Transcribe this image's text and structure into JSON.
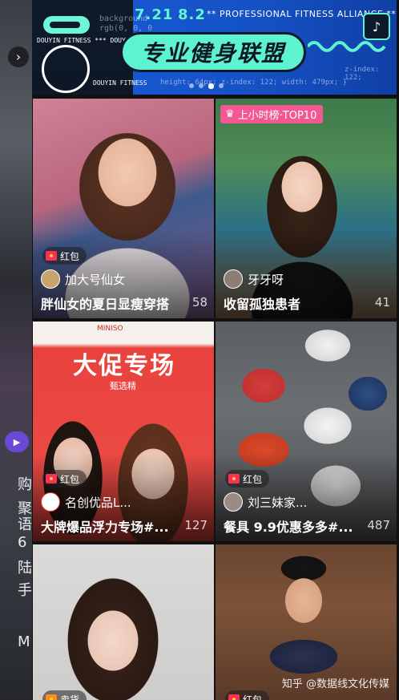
{
  "side": {
    "nav_arrow_icon": "chevron-right-icon",
    "text_items": [
      "购",
      "聚",
      "语",
      "6",
      "陆",
      "手",
      "M"
    ]
  },
  "banner": {
    "date1": "7.21",
    "date2": "8.2",
    "alliance": "** PROFESSIONAL  FITNESS  ALLIANCE **",
    "headline": "专业健身联盟",
    "code_line1": "background",
    "code_line2": "rgb(0, 0, 0",
    "code_line3": "height: 64px; z-index: 122; width: 479px; }",
    "code_line4": "z-index: 122;",
    "ring_tag1": "DOUYIN FITNESS *** DOUYIN FIT",
    "ring_tag2": "DOUYIN FITNESS",
    "colors": {
      "accent": "#5ef3d0",
      "blue": "#1a5bd9"
    }
  },
  "cards": [
    {
      "badge": "红包",
      "author": "加大号仙女",
      "title": "胖仙女的夏日显瘦穿搭",
      "count": "58",
      "rank": ""
    },
    {
      "badge": "",
      "author": "牙牙呀",
      "title": "收留孤独患者",
      "count": "41",
      "rank": "上小时榜·TOP10"
    },
    {
      "badge": "红包",
      "author": "名创优品L...",
      "title": "大牌爆品浮力专场#...",
      "count": "127",
      "rank": "",
      "poster_title": "大促专场",
      "poster_sub": "甄选精",
      "poster_brand": "MINISO"
    },
    {
      "badge": "红包",
      "author": "刘三妹家...",
      "title": "餐具 9.9优惠多多#...",
      "count": "487",
      "rank": ""
    },
    {
      "badge": "卖货",
      "author": "",
      "title": "",
      "count": "",
      "rank": ""
    },
    {
      "badge": "红包",
      "author": "",
      "title": "",
      "count": "",
      "rank": ""
    }
  ],
  "watermark": "知乎 @数据线文化传媒"
}
